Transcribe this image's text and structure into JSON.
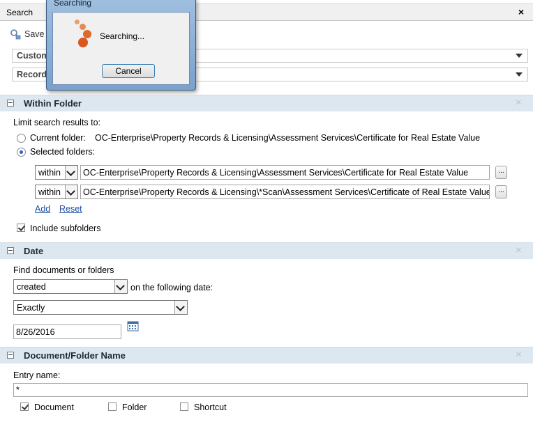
{
  "panel": {
    "title": "Search",
    "close_glyph": "×"
  },
  "toolbar": {
    "save_label": "Save"
  },
  "criteria_rows": [
    {
      "label": "Custom"
    },
    {
      "label": "Record"
    }
  ],
  "dialog": {
    "title": "Searching",
    "message": "Searching...",
    "cancel_label": "Cancel",
    "spinner_color": "#e0662a"
  },
  "within_folder": {
    "title": "Within Folder",
    "limit_label": "Limit search results to:",
    "current_folder_label": "Current folder:",
    "current_folder_path": "OC-Enterprise\\Property Records & Licensing\\Assessment Services\\Certificate for Real Estate Value",
    "selected_folders_label": "Selected folders:",
    "selected_checked": true,
    "rows": [
      {
        "scope": "within",
        "path": "OC-Enterprise\\Property Records & Licensing\\Assessment Services\\Certificate for Real Estate Value"
      },
      {
        "scope": "within",
        "path": "OC-Enterprise\\Property Records & Licensing\\*Scan\\Assessment Services\\Certificate of Real Estate Value"
      }
    ],
    "browse_label": "...",
    "add_label": "Add",
    "reset_label": "Reset",
    "include_subfolders_label": "Include subfolders",
    "include_subfolders_checked": true
  },
  "date": {
    "title": "Date",
    "find_label": "Find documents or folders",
    "type_value": "created",
    "following_label": "on the following date:",
    "mode_value": "Exactly",
    "date_value": "8/26/2016"
  },
  "name": {
    "title": "Document/Folder Name",
    "entry_label": "Entry name:",
    "entry_value": "*",
    "options": [
      {
        "label": "Document",
        "checked": true
      },
      {
        "label": "Folder",
        "checked": false
      },
      {
        "label": "Shortcut",
        "checked": false
      }
    ]
  },
  "colors": {
    "section_header_bg": "#dde7ef",
    "link": "#1d4fa3"
  }
}
